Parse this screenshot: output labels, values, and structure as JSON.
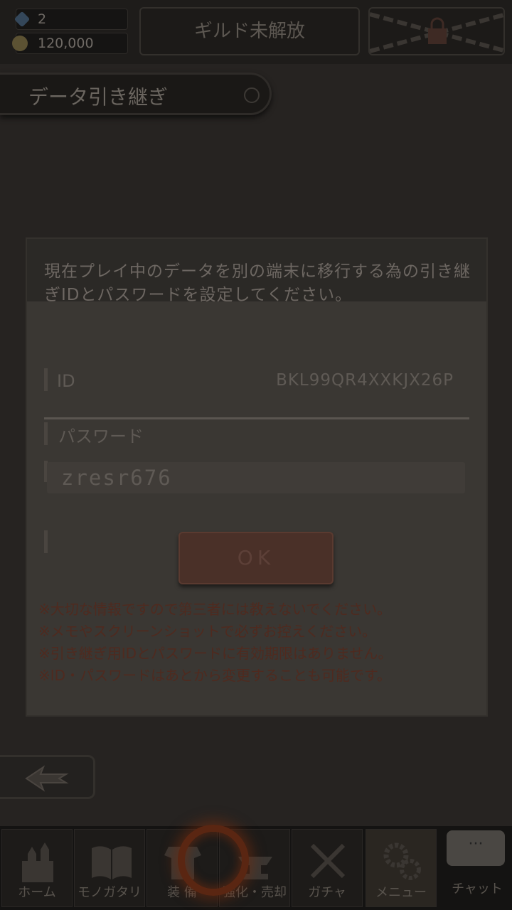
{
  "currency": {
    "gems": "2",
    "gold": "120,000"
  },
  "header": {
    "guild_label": "ギルド未解放"
  },
  "section": {
    "title": "データ引き継ぎ"
  },
  "dialog": {
    "description": "現在プレイ中のデータを別の端末に移行する為の引き継ぎIDとパスワードを設定してください。",
    "id_label": "ID",
    "id_value": "BKL99QR4XXKJX26P",
    "password_label": "パスワード",
    "password_value": "zresr676",
    "ok_label": "OK",
    "notes": [
      "※大切な情報ですので第三者には教えないでください。",
      "※メモやスクリーンショットで必ずお控えください。",
      "※引き継ぎ用IDとパスワードに有効期限はありません。",
      "※ID・パスワードはあとから変更することも可能です。"
    ]
  },
  "nav": {
    "items": [
      {
        "label": "ホーム",
        "icon": "castle-icon"
      },
      {
        "label": "モノガタリ",
        "icon": "book-icon"
      },
      {
        "label": "装 備",
        "icon": "armor-icon"
      },
      {
        "label": "強化・売却",
        "icon": "anvil-icon"
      },
      {
        "label": "ガチャ",
        "icon": "swords-icon"
      },
      {
        "label": "メニュー",
        "icon": "gears-icon"
      }
    ],
    "chat_label": "チャット",
    "chat_bubble": "···"
  },
  "colors": {
    "overlay_bg": "#262321",
    "ok_button": "#4a3028",
    "notes_text": "#4f2a1f",
    "ring_glow": "#5a2612"
  }
}
